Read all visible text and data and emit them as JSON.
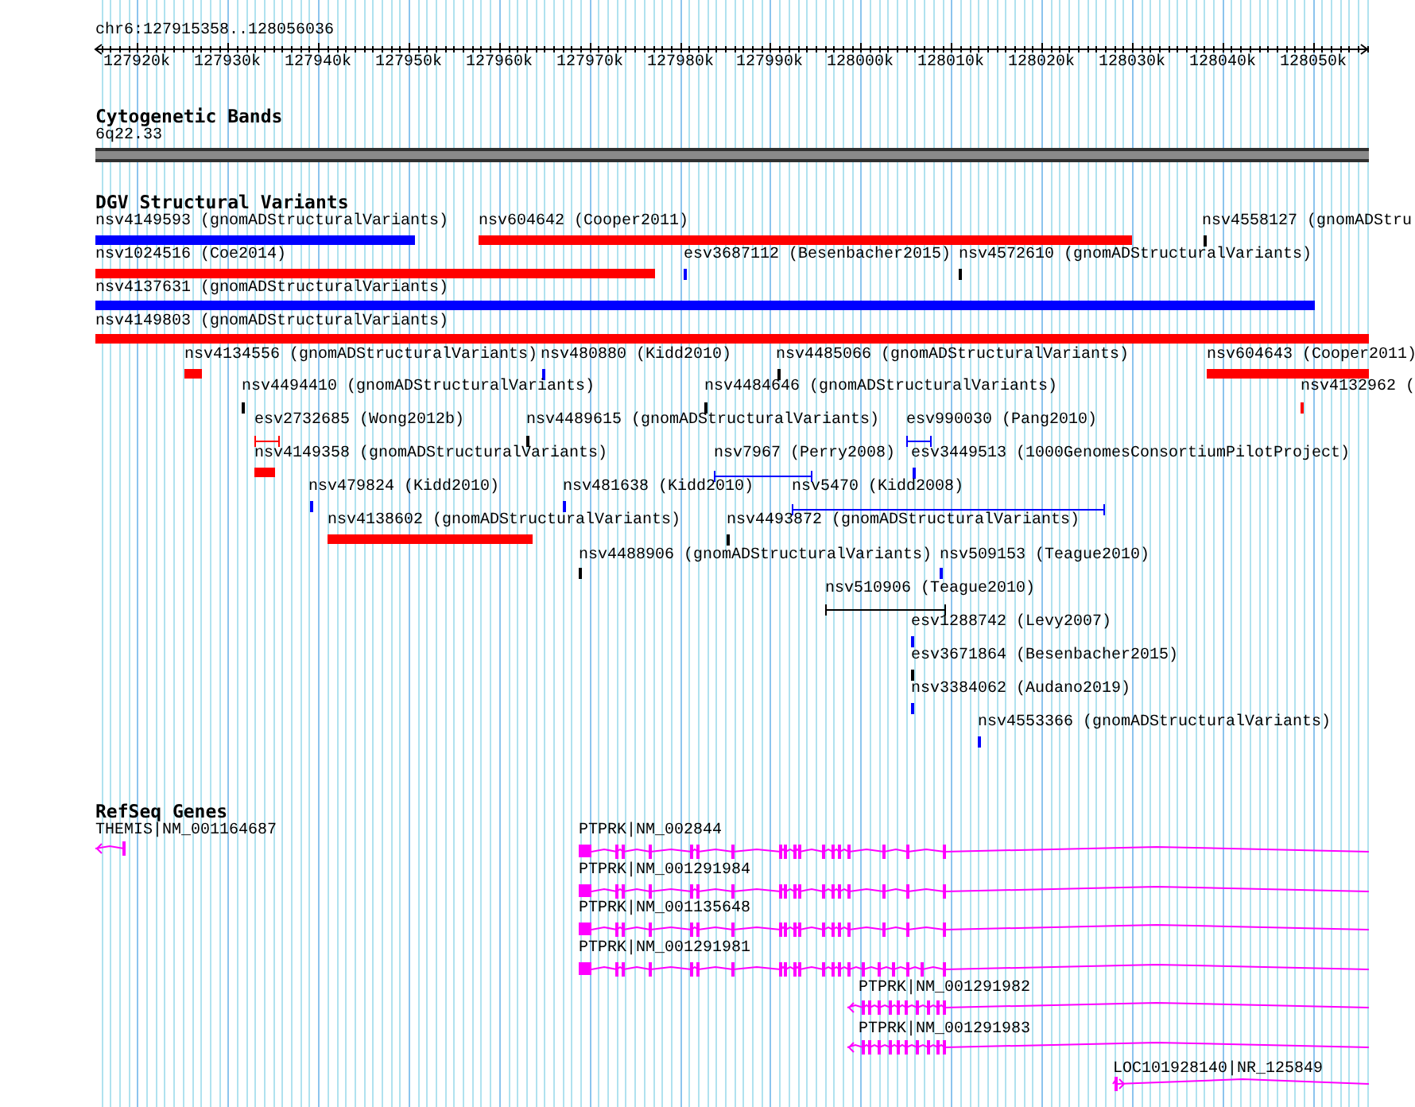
{
  "ruler": {
    "region": "chr6:127915358..128056036",
    "ticks": [
      "127920k",
      "127930k",
      "127940k",
      "127950k",
      "127960k",
      "127970k",
      "127980k",
      "127990k",
      "128000k",
      "128010k",
      "128020k",
      "128030k",
      "128040k",
      "128050k"
    ]
  },
  "cytoband": {
    "title": "Cytogenetic Bands",
    "band": "6q22.33"
  },
  "variants": {
    "title": "DGV Structural Variants",
    "features": [
      {
        "label": "nsv4149593 (gnomADStructuralVariants)",
        "kind": "bar",
        "color": "#0000ff"
      },
      {
        "label": "nsv604642 (Cooper2011)",
        "kind": "bar",
        "color": "#ff0000"
      },
      {
        "label": "nsv4558127 (gnomADStru",
        "kind": "tick",
        "color": "#000000"
      },
      {
        "label": "nsv1024516 (Coe2014)",
        "kind": "bar",
        "color": "#ff0000"
      },
      {
        "label": "esv3687112 (Besenbacher2015)",
        "kind": "tick",
        "color": "#0000ff"
      },
      {
        "label": "nsv4572610 (gnomADStructuralVariants)",
        "kind": "tick",
        "color": "#000000"
      },
      {
        "label": "nsv4137631 (gnomADStructuralVariants)",
        "kind": "bar",
        "color": "#0000ff"
      },
      {
        "label": "nsv4149803 (gnomADStructuralVariants)",
        "kind": "bar",
        "color": "#ff0000"
      },
      {
        "label": "nsv4134556 (gnomADStructuralVariants)",
        "kind": "bar",
        "color": "#ff0000"
      },
      {
        "label": "nsv480880 (Kidd2010)",
        "kind": "tick",
        "color": "#0000ff"
      },
      {
        "label": "nsv4485066 (gnomADStructuralVariants)",
        "kind": "tick",
        "color": "#000000"
      },
      {
        "label": "nsv604643 (Cooper2011)",
        "kind": "bar",
        "color": "#ff0000"
      },
      {
        "label": "nsv4494410 (gnomADStructuralVariants)",
        "kind": "tick",
        "color": "#000000"
      },
      {
        "label": "nsv4484646 (gnomADStructuralVariants)",
        "kind": "tick",
        "color": "#000000"
      },
      {
        "label": "nsv4132962 (",
        "kind": "tick",
        "color": "#ff0000"
      },
      {
        "label": "esv2732685 (Wong2012b)",
        "kind": "span",
        "color": "#ff0000"
      },
      {
        "label": "nsv4489615 (gnomADStructuralVariants)",
        "kind": "tick",
        "color": "#000000"
      },
      {
        "label": "esv990030 (Pang2010)",
        "kind": "span",
        "color": "#0000ff"
      },
      {
        "label": "nsv4149358 (gnomADStructuralVariants)",
        "kind": "bar",
        "color": "#ff0000"
      },
      {
        "label": "nsv7967 (Perry2008)",
        "kind": "span",
        "color": "#0000ff"
      },
      {
        "label": "esv3449513 (1000GenomesConsortiumPilotProject)",
        "kind": "tick",
        "color": "#0000ff"
      },
      {
        "label": "nsv479824 (Kidd2010)",
        "kind": "tick",
        "color": "#0000ff"
      },
      {
        "label": "nsv481638 (Kidd2010)",
        "kind": "tick",
        "color": "#0000ff"
      },
      {
        "label": "nsv5470 (Kidd2008)",
        "kind": "span",
        "color": "#0000ff"
      },
      {
        "label": "nsv4138602 (gnomADStructuralVariants)",
        "kind": "bar",
        "color": "#ff0000"
      },
      {
        "label": "nsv4493872 (gnomADStructuralVariants)",
        "kind": "tick",
        "color": "#000000"
      },
      {
        "label": "nsv4488906 (gnomADStructuralVariants)",
        "kind": "tick",
        "color": "#000000"
      },
      {
        "label": "nsv509153 (Teague2010)",
        "kind": "tick",
        "color": "#0000ff"
      },
      {
        "label": "nsv510906 (Teague2010)",
        "kind": "span",
        "color": "#000000"
      },
      {
        "label": "esv1288742 (Levy2007)",
        "kind": "tick",
        "color": "#0000ff"
      },
      {
        "label": "esv3671864 (Besenbacher2015)",
        "kind": "tick",
        "color": "#000000"
      },
      {
        "label": "nsv3384062 (Audano2019)",
        "kind": "tick",
        "color": "#0000ff"
      },
      {
        "label": "nsv4553366 (gnomADStructuralVariants)",
        "kind": "tick",
        "color": "#0000ff"
      }
    ]
  },
  "genes": {
    "title": "RefSeq Genes",
    "transcripts": [
      {
        "label": "THEMIS|NM_001164687"
      },
      {
        "label": "PTPRK|NM_002844"
      },
      {
        "label": "PTPRK|NM_001291984"
      },
      {
        "label": "PTPRK|NM_001135648"
      },
      {
        "label": "PTPRK|NM_001291981"
      },
      {
        "label": "PTPRK|NM_001291982"
      },
      {
        "label": "PTPRK|NM_001291983"
      },
      {
        "label": "LOC101928140|NR_125849"
      }
    ]
  }
}
